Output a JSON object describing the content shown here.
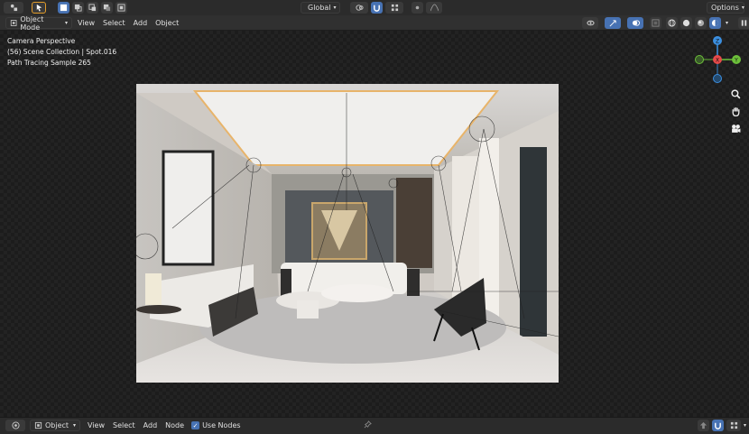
{
  "topbar": {
    "transform_orientation": "Global",
    "options_label": "Options"
  },
  "header": {
    "mode_label": "Object Mode",
    "menu": [
      "View",
      "Select",
      "Add",
      "Object"
    ]
  },
  "overlay_text": {
    "line1": "Camera Perspective",
    "line2": "(56) Scene Collection | Spot.016",
    "line3": "Path Tracing Sample 265"
  },
  "node_header": {
    "object_label": "Object",
    "menu": [
      "View",
      "Select",
      "Add",
      "Node"
    ],
    "use_nodes_label": "Use Nodes"
  },
  "colors": {
    "accent": "#4772b3",
    "selected_outline": "#e29c2a",
    "axis_x": "#e64a4a",
    "axis_y": "#6cbf3a",
    "axis_z": "#3b8fe0"
  }
}
